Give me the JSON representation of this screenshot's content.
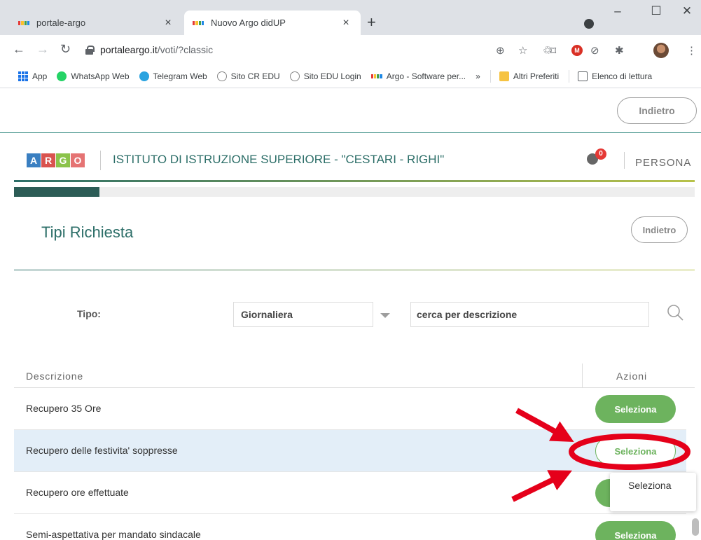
{
  "browser": {
    "tabs": [
      {
        "title": "portale-argo",
        "active": false
      },
      {
        "title": "Nuovo Argo didUP",
        "active": true
      }
    ],
    "close_glyph": "×",
    "new_tab_glyph": "+",
    "window": {
      "minimize": "–",
      "maximize": "☐",
      "close": "✕"
    },
    "url_host": "portaleargo.it",
    "url_path": "/voti/?classic",
    "bookmarks": [
      "App",
      "WhatsApp Web",
      "Telegram Web",
      "Sito CR EDU",
      "Sito EDU Login",
      "Argo - Software per...",
      "»",
      "Altri Preferiti",
      "Elenco di lettura"
    ]
  },
  "header": {
    "back_label": "Indietro"
  },
  "brand": {
    "logo_letters": [
      "A",
      "R",
      "G",
      "O"
    ],
    "logo_colors": [
      "#3a7fc1",
      "#d9534f",
      "#8bc34a",
      "#e57373"
    ],
    "school_name": "ISTITUTO DI ISTRUZIONE SUPERIORE - \"CESTARI - RIGHI\"",
    "notification_count": "0",
    "persona_label": "PERSONA"
  },
  "progress": {
    "fraction": 0.125
  },
  "page": {
    "title": "Tipi Richiesta",
    "back_label": "Indietro"
  },
  "filters": {
    "tipo_label": "Tipo:",
    "tipo_value": "Giornaliera",
    "search_value": "cerca per descrizione"
  },
  "table": {
    "headers": {
      "description": "Descrizione",
      "actions": "Azioni"
    },
    "rows": [
      {
        "description": "Recupero 35 Ore",
        "action": "Seleziona"
      },
      {
        "description": "Recupero delle festivita' soppresse",
        "action": "Seleziona"
      },
      {
        "description": "Recupero ore effettuate",
        "action": "Seleziona"
      },
      {
        "description": "Semi-aspettativa per mandato sindacale",
        "action": "Seleziona"
      }
    ]
  },
  "tooltip": {
    "text": "Seleziona"
  },
  "colors": {
    "accent_green": "#6db35e",
    "brand_teal": "#2c6e68",
    "annotation_red": "#e5001a"
  }
}
